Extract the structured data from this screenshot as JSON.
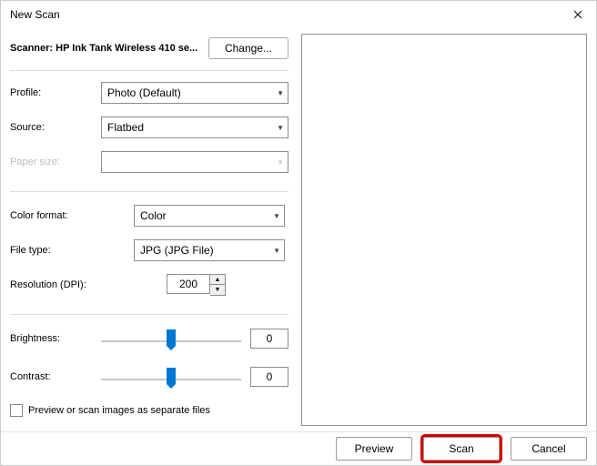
{
  "title": "New Scan",
  "scanner_label": "Scanner: HP Ink Tank Wireless 410 se...",
  "change_button": "Change...",
  "labels": {
    "profile": "Profile:",
    "source": "Source:",
    "paper_size": "Paper size:",
    "color_format": "Color format:",
    "file_type": "File type:",
    "resolution": "Resolution (DPI):",
    "brightness": "Brightness:",
    "contrast": "Contrast:"
  },
  "values": {
    "profile": "Photo (Default)",
    "source": "Flatbed",
    "paper_size": "",
    "color_format": "Color",
    "file_type": "JPG (JPG File)",
    "resolution": "200",
    "brightness": "0",
    "contrast": "0"
  },
  "checkbox_label": "Preview or scan images as separate files",
  "buttons": {
    "preview": "Preview",
    "scan": "Scan",
    "cancel": "Cancel"
  }
}
